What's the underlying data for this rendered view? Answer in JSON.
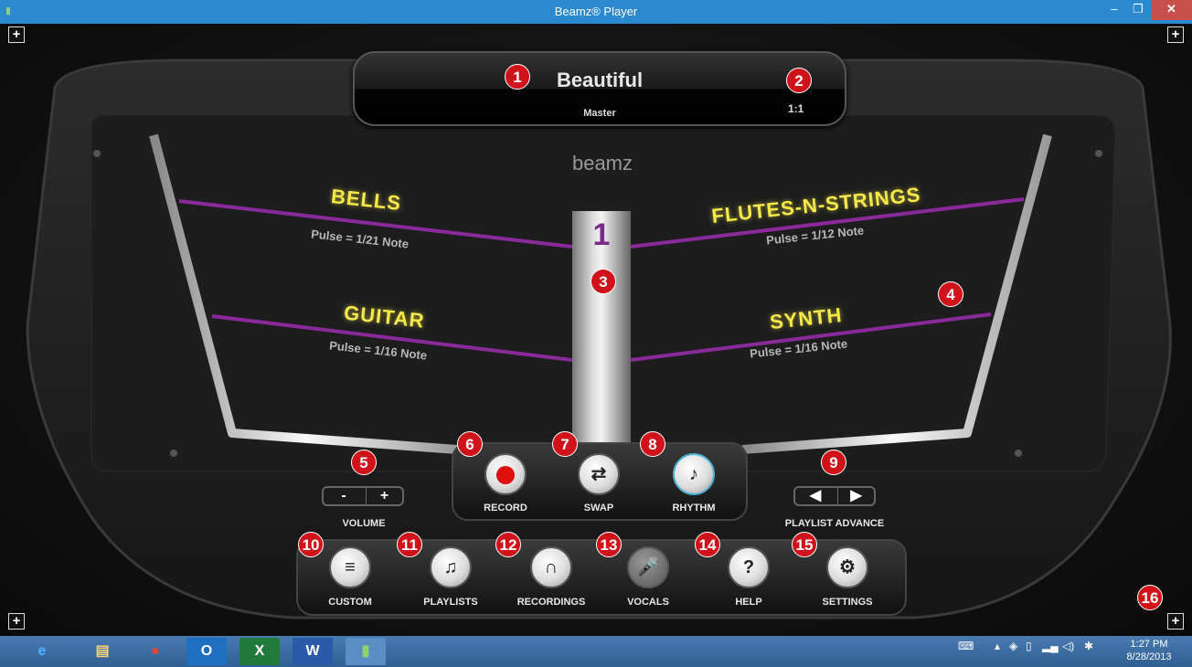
{
  "window": {
    "title": "Beamz® Player",
    "minimize": "–",
    "restore": "❐",
    "close": "✕"
  },
  "corner_buttons": {
    "symbol": "+"
  },
  "now_playing": {
    "title": "Beautiful",
    "subtitle": "Master",
    "position": "1:1"
  },
  "logo": {
    "text": "beamz"
  },
  "beam_number": "1",
  "instruments": [
    {
      "name": "BELLS",
      "pulse": "Pulse = 1/21 Note"
    },
    {
      "name": "FLUTES-N-STRINGS",
      "pulse": "Pulse = 1/12 Note"
    },
    {
      "name": "GUITAR",
      "pulse": "Pulse = 1/16 Note"
    },
    {
      "name": "SYNTH",
      "pulse": "Pulse = 1/16 Note"
    }
  ],
  "badges": [
    "1",
    "2",
    "3",
    "4",
    "5",
    "6",
    "7",
    "8",
    "9",
    "10",
    "11",
    "12",
    "13",
    "14",
    "15",
    "16"
  ],
  "volume": {
    "label": "VOLUME",
    "minus": "-",
    "plus": "+"
  },
  "playlist_advance": {
    "label": "PLAYLIST ADVANCE",
    "prev": "◀",
    "next": "▶"
  },
  "transport": {
    "record": "RECORD",
    "swap": "SWAP",
    "rhythm": "RHYTHM"
  },
  "menu": {
    "custom": "CUSTOM",
    "playlists": "PLAYLISTS",
    "recordings": "RECORDINGS",
    "vocals": "VOCALS",
    "help": "HELP",
    "settings": "SETTINGS"
  },
  "taskbar": {
    "time": "1:27 PM",
    "date": "8/28/2013"
  },
  "colors": {
    "titlebar": "#2b89cf",
    "instrument_text": "#f5e94a",
    "beam": "#8a2a9a",
    "badge": "#d0121a"
  }
}
